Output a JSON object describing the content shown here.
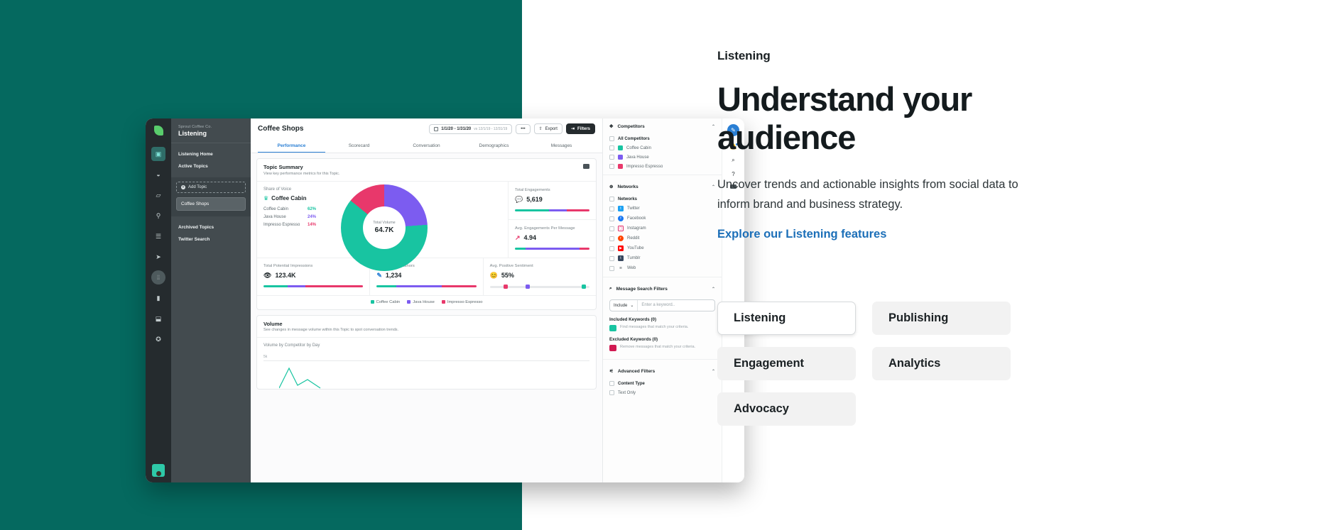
{
  "hero": {
    "eyebrow": "Listening",
    "headline": "Understand your audience",
    "subcopy": "Uncover trends and actionable insights from social data to inform brand and business strategy.",
    "cta": "Explore our Listening features",
    "accent_color": "#1c6fb8",
    "panel_color": "#05695f"
  },
  "feature_tabs": [
    {
      "label": "Listening",
      "active": true
    },
    {
      "label": "Publishing",
      "active": false
    },
    {
      "label": "Engagement",
      "active": false
    },
    {
      "label": "Analytics",
      "active": false
    },
    {
      "label": "Advocacy",
      "active": false
    }
  ],
  "app": {
    "rail": {
      "logo": "sprout-leaf-logo",
      "icons": [
        "inbox-icon",
        "compass-icon",
        "publish-icon",
        "pin-icon",
        "list-icon",
        "send-icon",
        "listening-icon",
        "analytics-icon",
        "bot-icon",
        "star-icon"
      ],
      "avatar": "user-avatar"
    },
    "sidebar": {
      "org": "Sprout Coffee Co.",
      "title": "Listening",
      "links": [
        {
          "label": "Listening Home",
          "selected": false
        },
        {
          "label": "Active Topics",
          "selected": true
        }
      ],
      "add_topic": "Add Topic",
      "topic": "Coffee Shops",
      "footer_links": [
        "Archived Topics",
        "Twitter Search"
      ]
    },
    "header": {
      "title": "Coffee Shops",
      "date_range": "1/1/20 - 1/31/20",
      "date_compare": "vs 12/1/19 - 12/31/19",
      "more_label": "•••",
      "export_label": "Export",
      "filters_label": "Filters"
    },
    "tabs": [
      {
        "label": "Performance",
        "active": true
      },
      {
        "label": "Scorecard",
        "active": false
      },
      {
        "label": "Conversation",
        "active": false
      },
      {
        "label": "Demographics",
        "active": false
      },
      {
        "label": "Messages",
        "active": false
      }
    ],
    "summary": {
      "title": "Topic Summary",
      "subtitle": "View key performance metrics for this Topic.",
      "share_of_voice_label": "Share of Voice",
      "winner": "Coffee Cabin",
      "rows": [
        {
          "name": "Coffee Cabin",
          "pct": "62%",
          "color": "#18c4a1"
        },
        {
          "name": "Java House",
          "pct": "24%",
          "color": "#7c5cf0"
        },
        {
          "name": "Impresso Espresso",
          "pct": "14%",
          "color": "#e8386b"
        }
      ],
      "donut_center_label": "Total Volume",
      "donut_center_value": "64.7K",
      "total_engagements_label": "Total Engagements",
      "total_engagements_value": "5,619",
      "avg_engagements_label": "Avg. Engagements Per Message",
      "avg_engagements_value": "4.94",
      "impressions_label": "Total Potential Impressions",
      "impressions_value": "123.4K",
      "authors_label": "Total Unique Authors",
      "authors_value": "1,234",
      "sentiment_label": "Avg. Positive Sentiment",
      "sentiment_value": "55%"
    },
    "volume": {
      "title": "Volume",
      "subtitle": "See changes in message volume within this Topic to spot conversation trends.",
      "chart_label": "Volume by Competitor by Day",
      "axis_tick": "5k"
    },
    "filters": {
      "competitors_label": "Competitors",
      "all_competitors": "All Competitors",
      "competitors": [
        {
          "label": "Coffee Cabin",
          "color": "#18c4a1"
        },
        {
          "label": "Java House",
          "color": "#7c5cf0"
        },
        {
          "label": "Impresso Espresso",
          "color": "#e8386b"
        }
      ],
      "networks_label": "Networks",
      "networks_sub": "Networks",
      "networks": [
        {
          "label": "Twitter",
          "glyph": "t",
          "color": "#1da1f2"
        },
        {
          "label": "Facebook",
          "glyph": "f",
          "color": "#1877f2"
        },
        {
          "label": "Instagram",
          "glyph": "o",
          "color": "#e1306c"
        },
        {
          "label": "Reddit",
          "glyph": "r",
          "color": "#ff4500"
        },
        {
          "label": "YouTube",
          "glyph": "▶",
          "color": "#ff0000"
        },
        {
          "label": "Tumblr",
          "glyph": "t",
          "color": "#36465d"
        },
        {
          "label": "Web",
          "glyph": "≋",
          "color": "#4a5358"
        }
      ],
      "search_filters_label": "Message Search Filters",
      "include_select": "Include",
      "keyword_placeholder": "Enter a keyword..",
      "included_keywords_label": "Included Keywords (0)",
      "included_keywords_desc": "Find messages that match your criteria.",
      "excluded_keywords_label": "Excluded Keywords (0)",
      "excluded_keywords_desc": "Remove messages that match your criteria.",
      "advanced_filters_label": "Advanced Filters",
      "content_type_label": "Content Type",
      "text_only_label": "Text Only"
    },
    "mini_rail": {
      "compose": "compose-icon",
      "bell": "bell-icon",
      "search": "search-icon",
      "help": "help-icon",
      "keyboard": "keyboard-icon"
    }
  }
}
